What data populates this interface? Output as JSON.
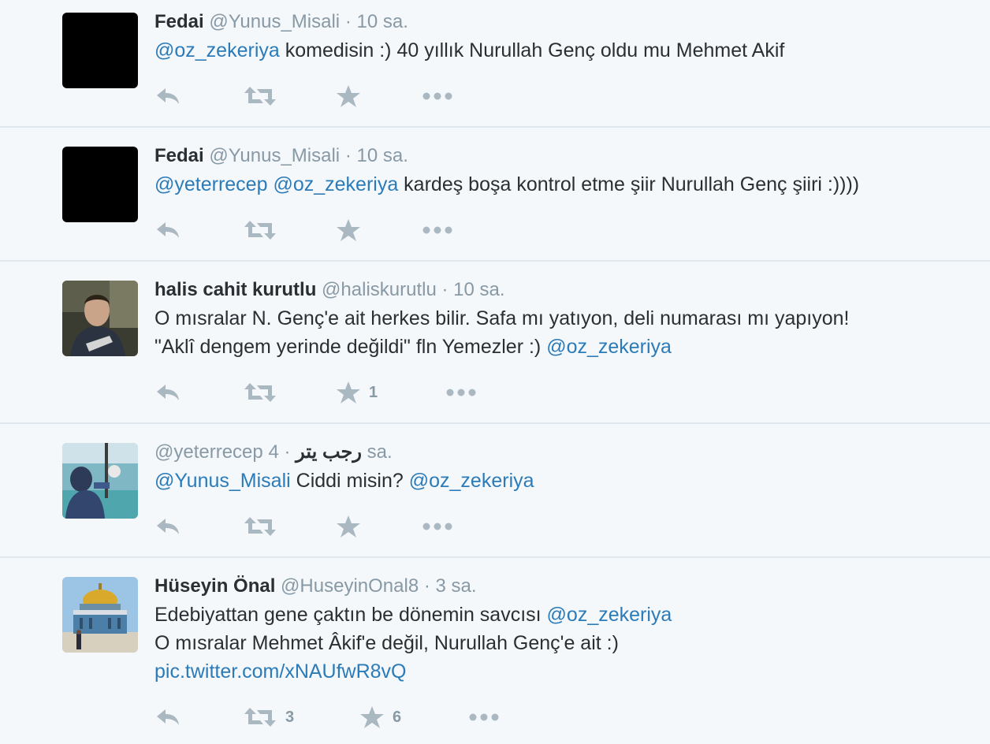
{
  "tweets": [
    {
      "fullname": "Fedai",
      "username": "@Yunus_Misali",
      "time": "10 sa.",
      "lines": [
        [
          {
            "t": "@oz_zekeriya",
            "link": true
          },
          {
            "t": " komedisin :) 40 yıllık Nurullah Genç oldu mu Mehmet Akif",
            "link": false
          }
        ]
      ],
      "retweets": "",
      "favorites": ""
    },
    {
      "fullname": "Fedai",
      "username": "@Yunus_Misali",
      "time": "10 sa.",
      "lines": [
        [
          {
            "t": "@yeterrecep",
            "link": true
          },
          {
            "t": " ",
            "link": false
          },
          {
            "t": "@oz_zekeriya",
            "link": true
          },
          {
            "t": " kardeş boşa kontrol etme şiir Nurullah Genç şiiri :))))",
            "link": false
          }
        ]
      ],
      "retweets": "",
      "favorites": ""
    },
    {
      "fullname": "halis cahit kurutlu",
      "username": "@haliskurutlu",
      "time": "10 sa.",
      "lines": [
        [
          {
            "t": "O mısralar N. Genç'e ait herkes bilir. Safa mı yatıyon, deli numarası mı yapıyon!",
            "link": false
          }
        ],
        [
          {
            "t": "\"Aklî dengem yerinde değildi\" fln Yemezler :) ",
            "link": false
          },
          {
            "t": "@oz_zekeriya",
            "link": true
          }
        ]
      ],
      "retweets": "",
      "favorites": "1"
    },
    {
      "fullname": "رجب يتر",
      "username": "@yeterrecep",
      "time": "4 sa.",
      "lines": [
        [
          {
            "t": "@Yunus_Misali",
            "link": true
          },
          {
            "t": " Ciddi misin? ",
            "link": false
          },
          {
            "t": "@oz_zekeriya",
            "link": true
          }
        ]
      ],
      "retweets": "",
      "favorites": ""
    },
    {
      "fullname": "Hüseyin Önal",
      "username": "@HuseyinOnal8",
      "time": "3 sa.",
      "lines": [
        [
          {
            "t": "Edebiyattan gene çaktın be dönemin savcısı ",
            "link": false
          },
          {
            "t": "@oz_zekeriya",
            "link": true
          }
        ],
        [
          {
            "t": "O mısralar Mehmet Âkif'e değil, Nurullah Genç'e ait :)",
            "link": false
          }
        ],
        [
          {
            "t": "pic.twitter.com/xNAUfwR8vQ",
            "link": true
          }
        ]
      ],
      "retweets": "3",
      "favorites": "6"
    }
  ],
  "header": {
    "separator": "·"
  },
  "icons": {
    "reply": "reply-icon",
    "retweet": "retweet-icon",
    "favorite": "star-icon",
    "more": "more-icon"
  },
  "colors": {
    "background": "#f5f8fa",
    "link": "#2b7bb9",
    "muted": "#8899a6",
    "icon": "#aab8c2",
    "text": "#292f33"
  }
}
